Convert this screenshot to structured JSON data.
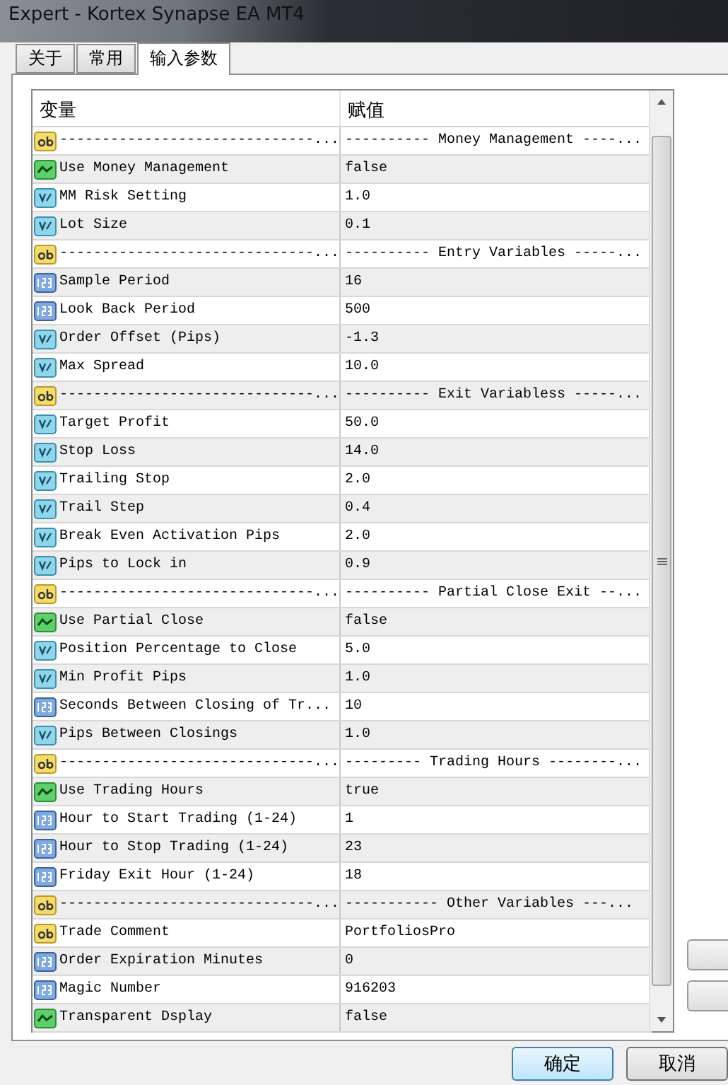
{
  "window": {
    "title": "Expert - Kortex Synapse EA MT4"
  },
  "tabs": [
    {
      "label": "关于",
      "selected": false
    },
    {
      "label": "常用",
      "selected": false
    },
    {
      "label": "输入参数",
      "selected": true
    }
  ],
  "table": {
    "columns": [
      "变量",
      "赋值"
    ],
    "rows": [
      {
        "kind": "string",
        "name": "------------------------------...",
        "value": "---------- Money Management ----..."
      },
      {
        "kind": "bool",
        "name": "Use Money Management",
        "value": "false"
      },
      {
        "kind": "double",
        "name": "MM Risk Setting",
        "value": "1.0"
      },
      {
        "kind": "double",
        "name": "Lot Size",
        "value": "0.1"
      },
      {
        "kind": "string",
        "name": "------------------------------...",
        "value": "---------- Entry Variables -----..."
      },
      {
        "kind": "int",
        "name": "Sample Period",
        "value": "16"
      },
      {
        "kind": "int",
        "name": "Look Back Period",
        "value": "500"
      },
      {
        "kind": "double",
        "name": "Order Offset (Pips)",
        "value": "-1.3"
      },
      {
        "kind": "double",
        "name": "Max Spread",
        "value": "10.0"
      },
      {
        "kind": "string",
        "name": "------------------------------...",
        "value": "---------- Exit Variabless -----..."
      },
      {
        "kind": "double",
        "name": "Target Profit",
        "value": "50.0"
      },
      {
        "kind": "double",
        "name": "Stop Loss",
        "value": "14.0"
      },
      {
        "kind": "double",
        "name": "Trailing Stop",
        "value": "2.0"
      },
      {
        "kind": "double",
        "name": "Trail Step",
        "value": "0.4"
      },
      {
        "kind": "double",
        "name": "Break Even Activation Pips",
        "value": "2.0"
      },
      {
        "kind": "double",
        "name": "Pips to Lock in",
        "value": "0.9"
      },
      {
        "kind": "string",
        "name": "------------------------------...",
        "value": "---------- Partial Close Exit --..."
      },
      {
        "kind": "bool",
        "name": "Use Partial Close",
        "value": "false"
      },
      {
        "kind": "double",
        "name": "Position Percentage to Close",
        "value": "5.0"
      },
      {
        "kind": "double",
        "name": "Min Profit Pips",
        "value": "1.0"
      },
      {
        "kind": "int",
        "name": "Seconds Between Closing of Tr...",
        "value": "10"
      },
      {
        "kind": "double",
        "name": "Pips Between Closings",
        "value": "1.0"
      },
      {
        "kind": "string",
        "name": "------------------------------...",
        "value": "--------- Trading Hours --------..."
      },
      {
        "kind": "bool",
        "name": "Use Trading Hours",
        "value": "true"
      },
      {
        "kind": "int",
        "name": "Hour to Start Trading (1-24)",
        "value": "1"
      },
      {
        "kind": "int",
        "name": "Hour to Stop Trading (1-24)",
        "value": "23"
      },
      {
        "kind": "int",
        "name": "Friday Exit Hour (1-24)",
        "value": "18"
      },
      {
        "kind": "string",
        "name": "------------------------------...",
        "value": "----------- Other Variables ---..."
      },
      {
        "kind": "string",
        "name": "Trade Comment",
        "value": "PortfoliosPro"
      },
      {
        "kind": "int",
        "name": "Order Expiration Minutes",
        "value": "0"
      },
      {
        "kind": "int",
        "name": "Magic Number",
        "value": "916203"
      },
      {
        "kind": "bool",
        "name": "Transparent Dsplay",
        "value": "false"
      }
    ]
  },
  "buttons": [
    {
      "label": "确定",
      "kind": "default"
    },
    {
      "label": "取消",
      "kind": "normal"
    }
  ]
}
